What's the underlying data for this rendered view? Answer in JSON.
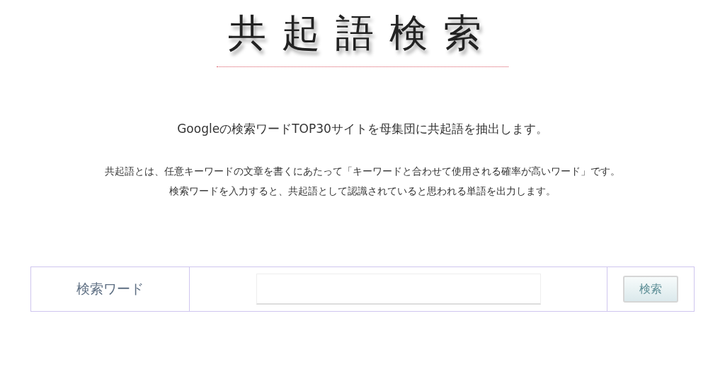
{
  "logo": {
    "title": "共起語検索"
  },
  "heading": "Googleの検索ワードTOP30サイトを母集団に共起語を抽出します。",
  "description": [
    "共起語とは、任意キーワードの文章を書くにあたって「キーワードと合わせて使用される確率が高いワード」です。",
    "検索ワードを入力すると、共起語として認識されていると思われる単語を出力します。"
  ],
  "search_form": {
    "label": "検索ワード",
    "button": "検索"
  }
}
